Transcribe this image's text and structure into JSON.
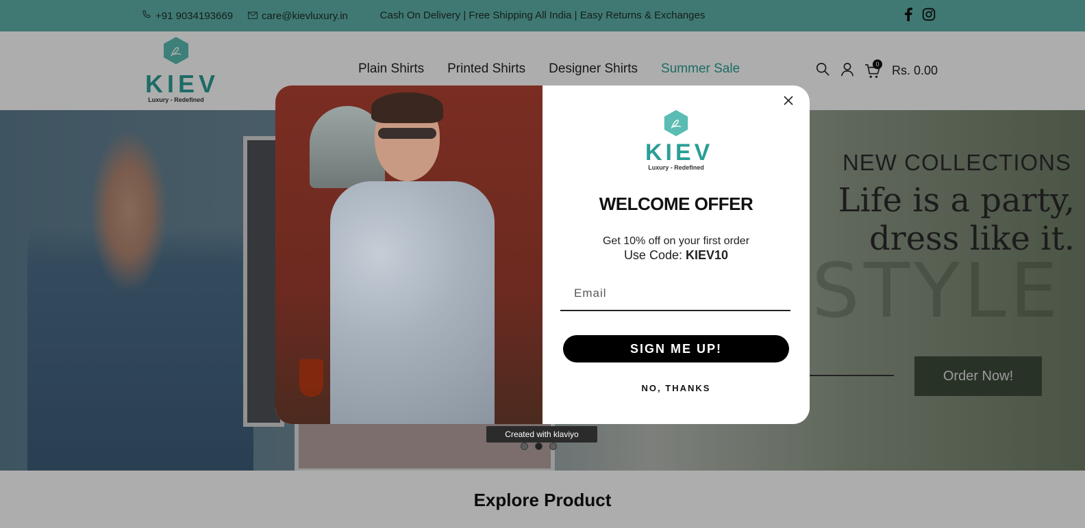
{
  "topbar": {
    "phone": "+91 9034193669",
    "email": "care@kievluxury.in",
    "promo": "Cash On Delivery | Free Shipping All India | Easy Returns & Exchanges",
    "social": [
      "facebook-icon",
      "instagram-icon"
    ],
    "bg_color": "#5fb3aa"
  },
  "header": {
    "logo": {
      "word": "KIEV",
      "tagline": "Luxury - Redefined"
    },
    "nav": [
      "Plain Shirts",
      "Printed Shirts",
      "Designer Shirts",
      "Summer Sale"
    ],
    "cart": {
      "count": "0",
      "total": "Rs. 0.00"
    }
  },
  "hero": {
    "new_collections": "NEW COLLECTIONS",
    "tagline": "Life is a party, dress like it.",
    "watermark": "STYLE",
    "cta": "Order Now!",
    "slides": 3,
    "active_slide": 2
  },
  "section": {
    "title": "Explore Product"
  },
  "popup": {
    "logo": {
      "word": "KIEV",
      "tagline": "Luxury - Redefined"
    },
    "heading": "WELCOME OFFER",
    "offer_text": "Get 10% off on your first order",
    "code_prefix": "Use Code:",
    "code": "KIEV10",
    "email_placeholder": "Email",
    "signup_label": "SIGN ME UP!",
    "decline_label": "NO, THANKS",
    "badge": "Created with klaviyo"
  },
  "colors": {
    "accent": "#2b9e95",
    "button": "#000000"
  }
}
